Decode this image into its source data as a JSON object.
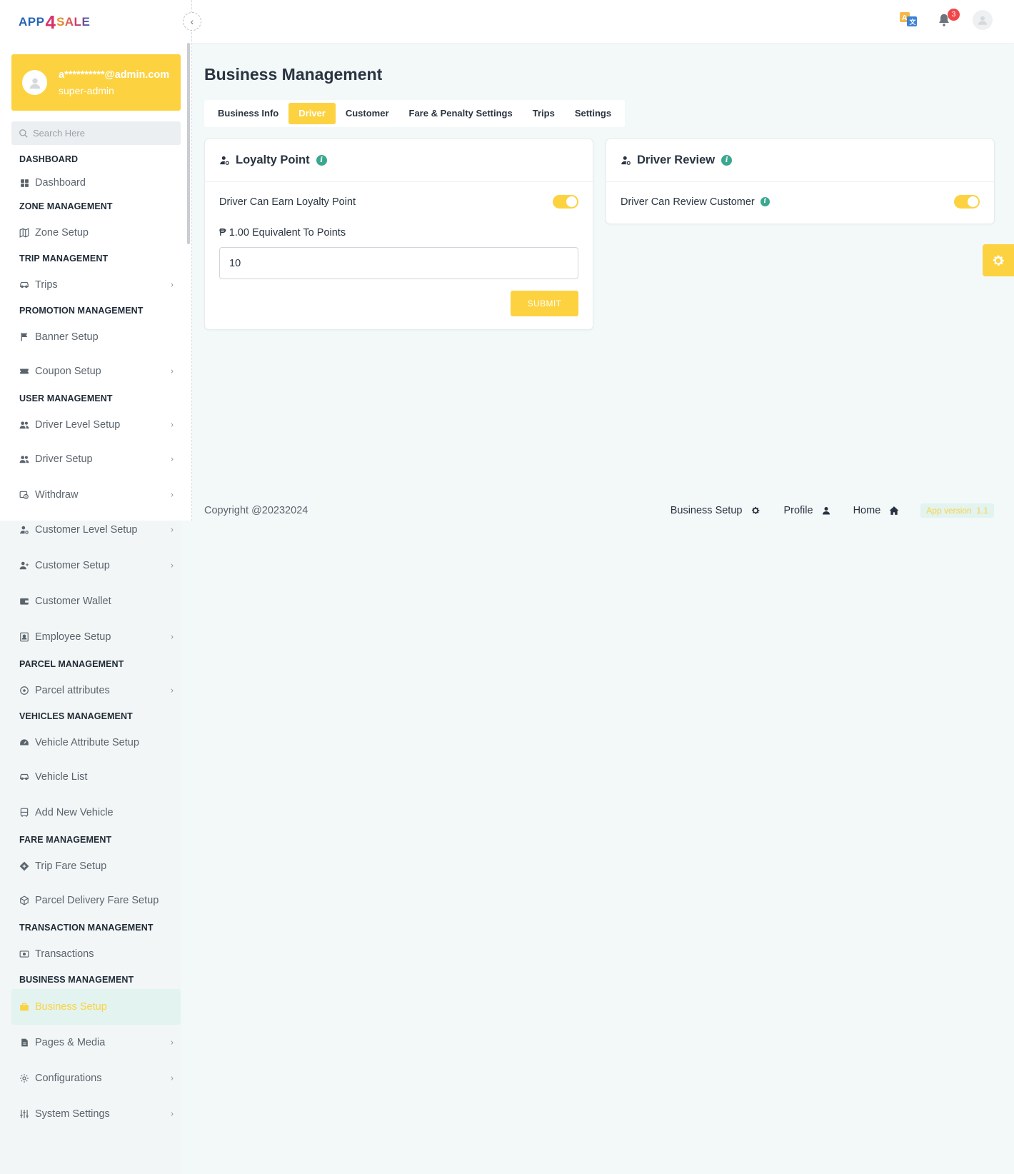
{
  "brand": {
    "logo_part1": "APP",
    "logo_part2": "4",
    "logo_part3": "SALE"
  },
  "user": {
    "email": "a**********@admin.com",
    "role": "super-admin"
  },
  "search": {
    "placeholder": "Search Here"
  },
  "sidebar": {
    "sections": [
      {
        "title": "DASHBOARD",
        "items": [
          {
            "label": "Dashboard",
            "icon": "grid-icon"
          }
        ]
      },
      {
        "title": "ZONE MANAGEMENT",
        "items": [
          {
            "label": "Zone Setup",
            "icon": "map-icon"
          }
        ]
      },
      {
        "title": "TRIP MANAGEMENT",
        "items": [
          {
            "label": "Trips",
            "icon": "car-icon",
            "chevron": true
          }
        ]
      },
      {
        "title": "PROMOTION MANAGEMENT",
        "items": [
          {
            "label": "Banner Setup",
            "icon": "flag-icon"
          },
          {
            "label": "Coupon Setup",
            "icon": "ticket-icon",
            "chevron": true
          }
        ]
      },
      {
        "title": "USER MANAGEMENT",
        "items": [
          {
            "label": "Driver Level Setup",
            "icon": "users-icon",
            "chevron": true
          },
          {
            "label": "Driver Setup",
            "icon": "users-icon",
            "chevron": true
          },
          {
            "label": "Withdraw",
            "icon": "withdraw-icon",
            "chevron": true
          },
          {
            "label": "Customer Level Setup",
            "icon": "user-cog-icon",
            "chevron": true
          },
          {
            "label": "Customer Setup",
            "icon": "user-plus-icon",
            "chevron": true
          },
          {
            "label": "Customer Wallet",
            "icon": "wallet-icon"
          },
          {
            "label": "Employee Setup",
            "icon": "id-card-icon",
            "chevron": true
          }
        ]
      },
      {
        "title": "PARCEL MANAGEMENT",
        "items": [
          {
            "label": "Parcel attributes",
            "icon": "circle-icon",
            "chevron": true
          }
        ]
      },
      {
        "title": "VEHICLES MANAGEMENT",
        "items": [
          {
            "label": "Vehicle Attribute Setup",
            "icon": "gauge-icon"
          },
          {
            "label": "Vehicle List",
            "icon": "car-icon"
          },
          {
            "label": "Add New Vehicle",
            "icon": "bus-icon"
          }
        ]
      },
      {
        "title": "FARE MANAGEMENT",
        "items": [
          {
            "label": "Trip Fare Setup",
            "icon": "diamond-icon"
          },
          {
            "label": "Parcel Delivery Fare Setup",
            "icon": "box-icon"
          }
        ]
      },
      {
        "title": "TRANSACTION MANAGEMENT",
        "items": [
          {
            "label": "Transactions",
            "icon": "cash-icon"
          }
        ]
      },
      {
        "title": "BUSINESS MANAGEMENT",
        "items": [
          {
            "label": "Business Setup",
            "icon": "briefcase-icon",
            "active": true
          },
          {
            "label": "Pages & Media",
            "icon": "file-icon",
            "chevron": true
          },
          {
            "label": "Configurations",
            "icon": "gear-icon",
            "chevron": true
          },
          {
            "label": "System Settings",
            "icon": "sliders-icon",
            "chevron": true
          }
        ]
      }
    ]
  },
  "topbar": {
    "notification_count": "3"
  },
  "page": {
    "title": "Business Management",
    "tabs": [
      "Business Info",
      "Driver",
      "Customer",
      "Fare & Penalty Settings",
      "Trips",
      "Settings"
    ],
    "active_tab": "Driver"
  },
  "loyalty_card": {
    "title": "Loyalty Point",
    "toggle_label": "Driver Can Earn Loyalty Point",
    "toggle_on": true,
    "field_label": "₱ 1.00 Equivalent To Points",
    "field_value": "10",
    "submit_label": "SUBMIT"
  },
  "review_card": {
    "title": "Driver Review",
    "toggle_label": "Driver Can Review Customer",
    "toggle_on": true
  },
  "footer": {
    "copyright": "Copyright @20232024",
    "links": [
      "Business Setup",
      "Profile",
      "Home"
    ],
    "app_version_label": "App version",
    "app_version": "1.1"
  },
  "colors": {
    "accent": "#fcd240",
    "info": "#3aa88e",
    "active_bg": "#e2f3f0",
    "badge": "#f0484a"
  }
}
